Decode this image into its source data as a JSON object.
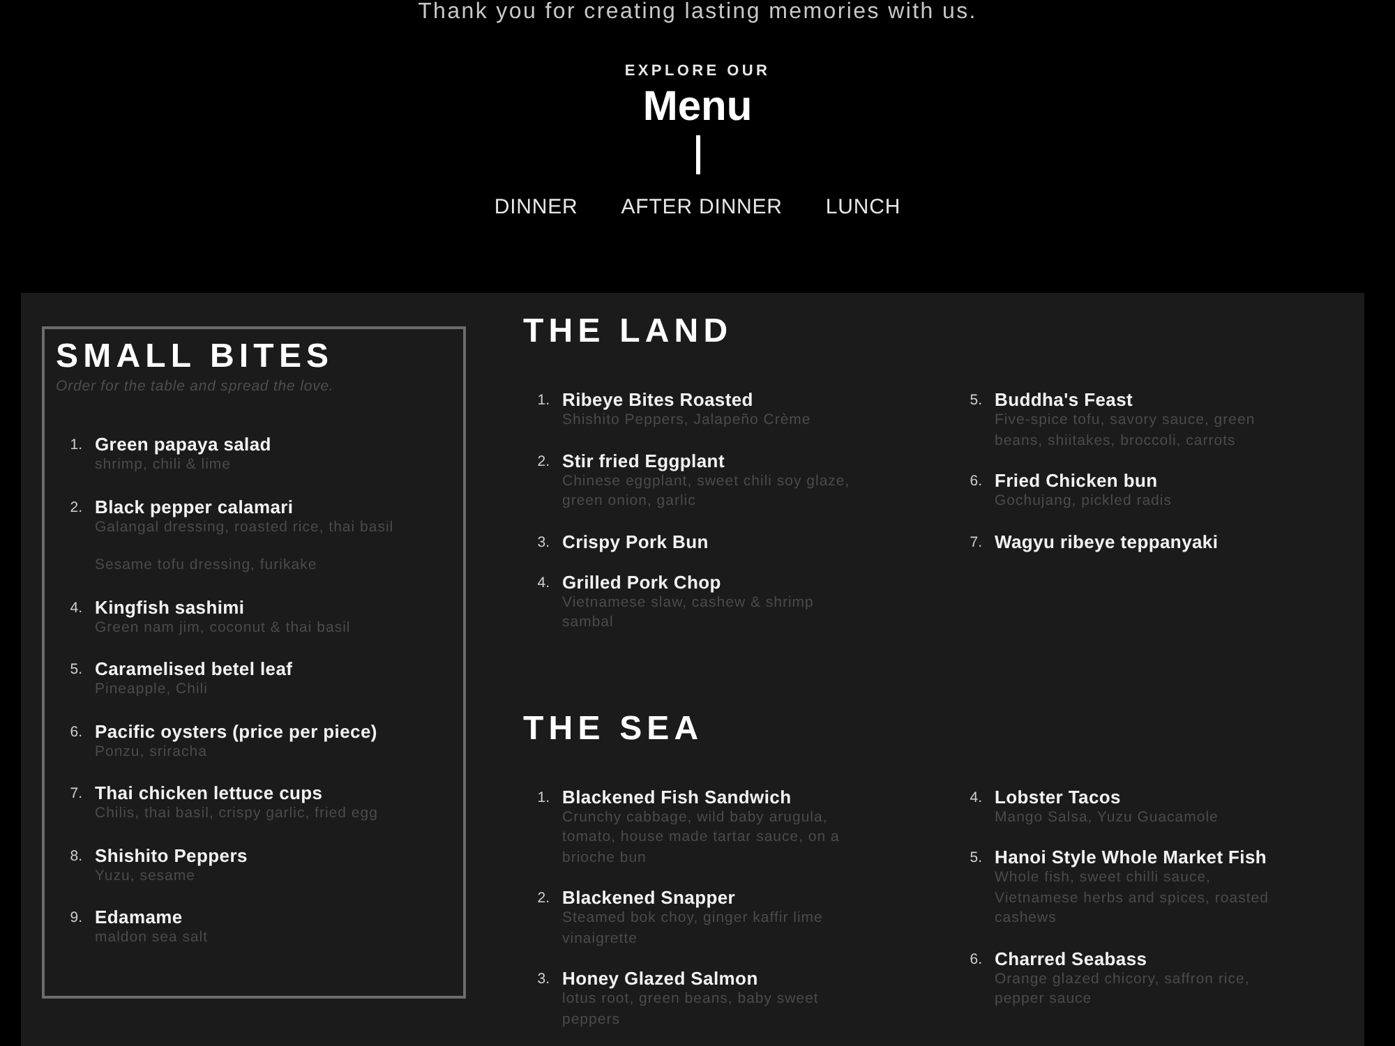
{
  "tagline": "Thank you for creating lasting memories with us.",
  "header": {
    "eyebrow": "EXPLORE OUR",
    "title": "Menu"
  },
  "tabs": [
    {
      "label": "DINNER",
      "selected": false
    },
    {
      "label": "AFTER DINNER",
      "selected": false
    },
    {
      "label": "LUNCH",
      "selected": false
    }
  ],
  "small_bites": {
    "title": "SMALL BITES",
    "subtitle": "Order for the table and spread the love.",
    "items": [
      {
        "number": "1.",
        "name": "Green papaya salad",
        "description": "shrimp, chili & lime"
      },
      {
        "number": "2.",
        "name": "Black pepper calamari",
        "description": "Galangal dressing, roasted rice, thai basil"
      },
      {
        "description": "Sesame tofu dressing, furikake"
      },
      {
        "number": "4.",
        "name": "Kingfish sashimi",
        "description": "Green nam jim, coconut & thai basil"
      },
      {
        "number": "5.",
        "name": "Caramelised betel leaf",
        "description": "Pineapple, Chili"
      },
      {
        "number": "6.",
        "name": "Pacific oysters (price per piece)",
        "description": "Ponzu, sriracha"
      },
      {
        "number": "7.",
        "name": "Thai chicken lettuce cups",
        "description": "Chilis, thai basil, crispy garlic, fried egg"
      },
      {
        "number": "8.",
        "name": "Shishito Peppers",
        "description": "Yuzu, sesame"
      },
      {
        "number": "9.",
        "name": "Edamame",
        "description": "maldon sea salt"
      }
    ]
  },
  "sections": [
    {
      "title": "THE LAND",
      "columns": [
        {
          "items": [
            {
              "number": "1.",
              "name": "Ribeye Bites Roasted",
              "description": "Shishito Peppers, Jalapeño Crème"
            },
            {
              "number": "2.",
              "name": "Stir fried Eggplant",
              "description": "Chinese eggplant, sweet chili soy glaze, green onion, garlic"
            },
            {
              "number": "3.",
              "name": "Crispy Pork Bun"
            },
            {
              "number": "4.",
              "name": "Grilled Pork Chop",
              "description": "Vietnamese slaw, cashew & shrimp sambal"
            }
          ]
        },
        {
          "items": [
            {
              "number": "5.",
              "name": "Buddha's Feast",
              "description": "Five-spice tofu, savory sauce, green beans, shiitakes, broccoli, carrots"
            },
            {
              "number": "6.",
              "name": "Fried Chicken bun",
              "description": "Gochujang, pickled radis"
            },
            {
              "number": "7.",
              "name": "Wagyu ribeye teppanyaki"
            }
          ]
        }
      ]
    },
    {
      "title": "THE SEA",
      "columns": [
        {
          "items": [
            {
              "number": "1.",
              "name": "Blackened Fish Sandwich",
              "description": "Crunchy cabbage, wild baby arugula, tomato, house made tartar sauce, on a brioche bun"
            },
            {
              "number": "2.",
              "name": "Blackened Snapper",
              "description": "Steamed bok choy, ginger kaffir lime vinaigrette"
            },
            {
              "number": "3.",
              "name": "Honey Glazed Salmon",
              "description": "lotus root, green beans, baby sweet peppers"
            }
          ]
        },
        {
          "items": [
            {
              "number": "4.",
              "name": "Lobster Tacos",
              "description": "Mango Salsa, Yuzu Guacamole"
            },
            {
              "number": "5.",
              "name": "Hanoi Style Whole Market Fish",
              "description": "Whole fish, sweet chilli sauce, Vietnamese herbs and spices, roasted cashews"
            },
            {
              "number": "6.",
              "name": "Charred Seabass",
              "description": "Orange glazed chicory, saffron rice, pepper sauce"
            }
          ]
        }
      ]
    }
  ]
}
